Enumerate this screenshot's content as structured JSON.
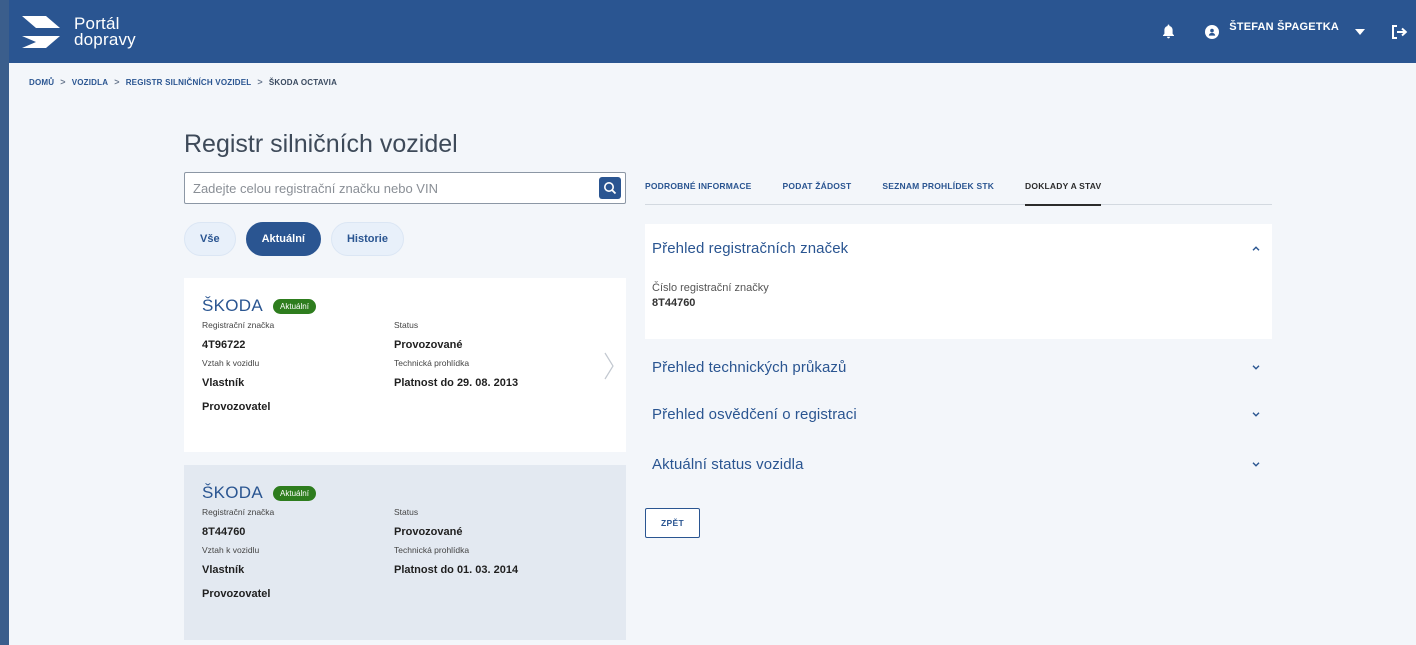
{
  "header": {
    "logo_line1": "Portál",
    "logo_line2": "dopravy",
    "username": "ŠTEFAN ŠPAGETKA"
  },
  "breadcrumb": [
    "DOMŮ",
    "VOZIDLA",
    "REGISTR SILNIČNÍCH VOZIDEL",
    "ŠKODA OCTAVIA"
  ],
  "page": {
    "title": "Registr silničních vozidel"
  },
  "search": {
    "placeholder": "Zadejte celou registrační značku nebo VIN",
    "value": ""
  },
  "filters": [
    "Vše",
    "Aktuální",
    "Historie"
  ],
  "filters_active": "Aktuální",
  "vehicles": [
    {
      "brand": "ŠKODA",
      "badge": "Aktuální",
      "plate_label": "Registrační značka",
      "plate": "4T96722",
      "status_label": "Status",
      "status": "Provozované",
      "relation_label": "Vztah k vozidlu",
      "relation_1": "Vlastník",
      "relation_2": "Provozovatel",
      "inspection_label": "Technická prohlídka",
      "inspection": "Platnost do 29. 08. 2013"
    },
    {
      "brand": "ŠKODA",
      "badge": "Aktuální",
      "plate_label": "Registrační značka",
      "plate": "8T44760",
      "status_label": "Status",
      "status": "Provozované",
      "relation_label": "Vztah k vozidlu",
      "relation_1": "Vlastník",
      "relation_2": "Provozovatel",
      "inspection_label": "Technická prohlídka",
      "inspection": "Platnost do 01. 03. 2014"
    }
  ],
  "tabs": [
    "PODROBNÉ INFORMACE",
    "PODAT ŽÁDOST",
    "SEZNAM PROHLÍDEK STK",
    "DOKLADY A STAV"
  ],
  "tabs_active": "DOKLADY A STAV",
  "sections": {
    "plates": {
      "title": "Přehled registračních značek",
      "field_label": "Číslo registrační značky",
      "field_value": "8T44760",
      "expanded": true
    },
    "tech_cards": {
      "title": "Přehled technických průkazů",
      "expanded": false
    },
    "certificates": {
      "title": "Přehled osvědčení o registraci",
      "expanded": false
    },
    "status": {
      "title": "Aktuální status vozidla",
      "expanded": false
    }
  },
  "back_button": "ZPĚT",
  "icons": {
    "bell": "bell-icon",
    "avatar": "user-avatar-icon",
    "caret": "caret-down-icon",
    "logout": "logout-icon",
    "search": "search-icon",
    "card_arrow": "chevron-right-icon",
    "accordion_open": "chevron-up-icon",
    "accordion_closed": "chevron-down-icon"
  },
  "colors": {
    "primary": "#2a5591",
    "badge_green": "#2e7d1e",
    "background": "#f3f6fa"
  }
}
